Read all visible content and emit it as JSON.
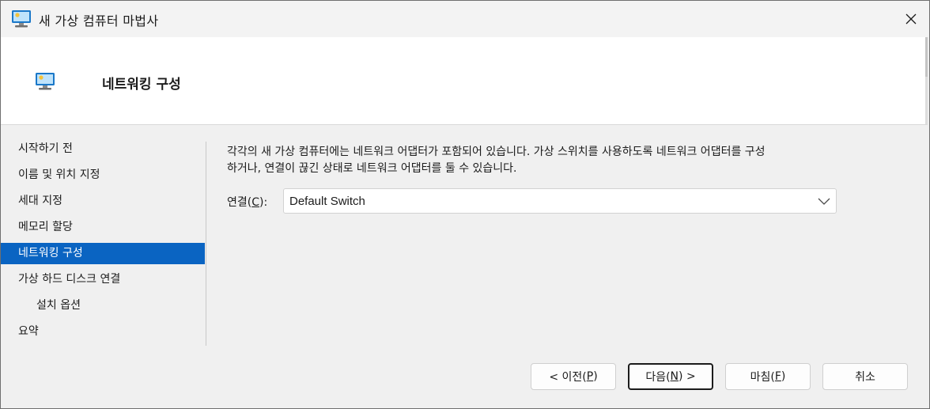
{
  "window": {
    "title": "새 가상 컴퓨터 마법사"
  },
  "header": {
    "title": "네트워킹 구성"
  },
  "nav": {
    "items": [
      {
        "label": "시작하기 전",
        "active": false,
        "sub": false
      },
      {
        "label": "이름 및 위치 지정",
        "active": false,
        "sub": false
      },
      {
        "label": "세대 지정",
        "active": false,
        "sub": false
      },
      {
        "label": "메모리 할당",
        "active": false,
        "sub": false
      },
      {
        "label": "네트워킹 구성",
        "active": true,
        "sub": false
      },
      {
        "label": "가상 하드 디스크 연결",
        "active": false,
        "sub": false
      },
      {
        "label": "설치 옵션",
        "active": false,
        "sub": true
      },
      {
        "label": "요약",
        "active": false,
        "sub": false
      }
    ]
  },
  "main": {
    "description_line1": "각각의 새 가상 컴퓨터에는 네트워크 어댑터가 포함되어 있습니다. 가상 스위치를 사용하도록 네트워크 어댑터를 구성",
    "description_line2": "하거나, 연결이 끊긴 상태로 네트워크 어댑터를 둘 수 있습니다.",
    "connection_label": "연결",
    "connection_mnemonic": "C",
    "connection_value": "Default Switch"
  },
  "buttons": {
    "prev_prefix": "< 이전(",
    "prev_key": "P",
    "prev_suffix": ")",
    "next_prefix": "다음(",
    "next_key": "N",
    "next_suffix": ") >",
    "finish_prefix": "마침(",
    "finish_key": "F",
    "finish_suffix": ")",
    "cancel_label": "취소"
  },
  "colors": {
    "accent": "#0a64c2",
    "title_bar": "#f3f3f3",
    "content_bg": "#f0f0f0"
  },
  "icons": {
    "window": "virtual-machine-icon",
    "header": "virtual-machine-icon",
    "close": "close-icon",
    "dropdown": "chevron-down-icon"
  }
}
